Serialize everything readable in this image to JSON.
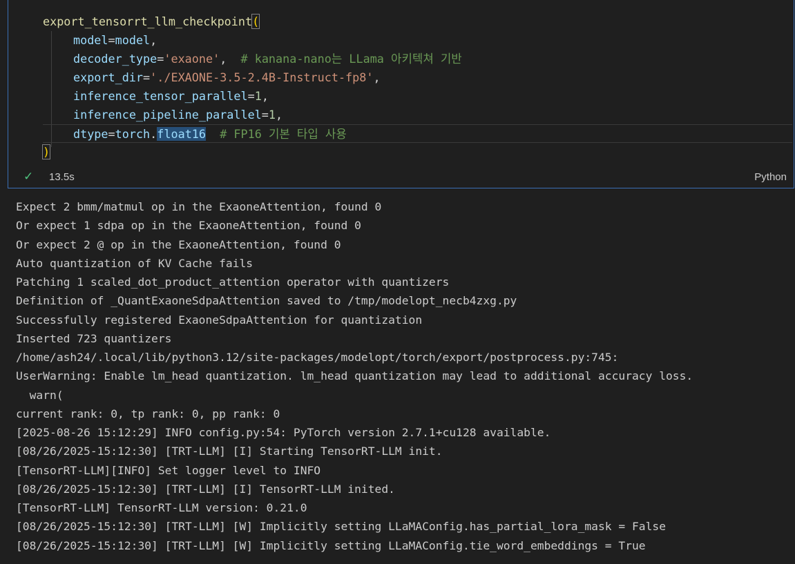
{
  "code": {
    "call_name": "export_tensorrt_llm_checkpoint",
    "open_paren": "(",
    "close_paren": ")",
    "args": [
      {
        "name": "model",
        "eq": "=",
        "value": "model",
        "comma": ",",
        "comment": ""
      },
      {
        "name": "decoder_type",
        "eq": "=",
        "value": "'exaone'",
        "comma": ",",
        "comment": "  # kanana-nano는 LLama 아키텍쳐 기반"
      },
      {
        "name": "export_dir",
        "eq": "=",
        "value": "'./EXAONE-3.5-2.4B-Instruct-fp8'",
        "comma": ",",
        "comment": ""
      },
      {
        "name": "inference_tensor_parallel",
        "eq": "=",
        "value": "1",
        "comma": ",",
        "comment": ""
      },
      {
        "name": "inference_pipeline_parallel",
        "eq": "=",
        "value": "1",
        "comma": ",",
        "comment": ""
      }
    ],
    "last_arg": {
      "name": "dtype",
      "eq": "=",
      "module": "torch",
      "dot": ".",
      "attr": "float16",
      "comment": "  # FP16 기본 타입 사용"
    }
  },
  "status": {
    "check_icon": "✓",
    "duration": "13.5s",
    "language": "Python"
  },
  "output_lines": [
    "Expect 2 bmm/matmul op in the ExaoneAttention, found 0",
    "Or expect 1 sdpa op in the ExaoneAttention, found 0",
    "Or expect 2 @ op in the ExaoneAttention, found 0",
    "Auto quantization of KV Cache fails",
    "Patching 1 scaled_dot_product_attention operator with quantizers",
    "Definition of _QuantExaoneSdpaAttention saved to /tmp/modelopt_necb4zxg.py",
    "Successfully registered ExaoneSdpaAttention for quantization",
    "Inserted 723 quantizers",
    "/home/ash24/.local/lib/python3.12/site-packages/modelopt/torch/export/postprocess.py:745:",
    "UserWarning: Enable lm_head quantization. lm_head quantization may lead to additional accuracy loss.",
    "  warn(",
    "current rank: 0, tp rank: 0, pp rank: 0",
    "[2025-08-26 15:12:29] INFO config.py:54: PyTorch version 2.7.1+cu128 available.",
    "[08/26/2025-15:12:30] [TRT-LLM] [I] Starting TensorRT-LLM init.",
    "[TensorRT-LLM][INFO] Set logger level to INFO",
    "[08/26/2025-15:12:30] [TRT-LLM] [I] TensorRT-LLM inited.",
    "[TensorRT-LLM] TensorRT-LLM version: 0.21.0",
    "[08/26/2025-15:12:30] [TRT-LLM] [W] Implicitly setting LLaMAConfig.has_partial_lora_mask = False",
    "[08/26/2025-15:12:30] [TRT-LLM] [W] Implicitly setting LLaMAConfig.tie_word_embeddings = True"
  ],
  "colors": {
    "background": "#1f1f1f",
    "cell_border": "#3b6fb6",
    "function": "#dcdcaa",
    "parameter": "#9cdcfe",
    "string": "#ce9178",
    "number": "#b5cea8",
    "comment": "#6a9955",
    "bracket": "#ffd700",
    "success": "#4ec27e"
  }
}
